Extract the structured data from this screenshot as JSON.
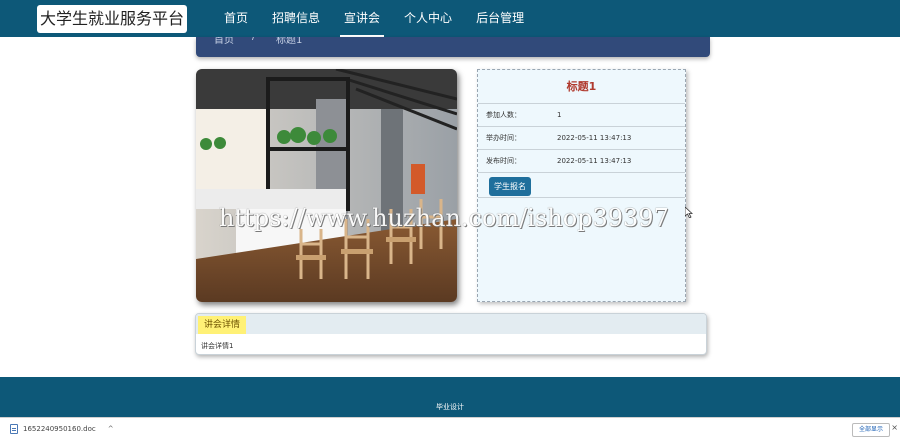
{
  "brand": {
    "title": "大学生就业服务平台"
  },
  "nav": {
    "items": [
      {
        "label": "首页",
        "active": false
      },
      {
        "label": "招聘信息",
        "active": false
      },
      {
        "label": "宣讲会",
        "active": true
      },
      {
        "label": "个人中心",
        "active": false
      },
      {
        "label": "后台管理",
        "active": false
      }
    ]
  },
  "breadcrumb": {
    "home": "首页",
    "separator": "/",
    "current": "标题1"
  },
  "event": {
    "title": "标题1",
    "fields": [
      {
        "label": "参加人数：",
        "value": "1"
      },
      {
        "label": "举办时间：",
        "value": "2022-05-11 13:47:13"
      },
      {
        "label": "发布时间：",
        "value": "2022-05-11 13:47:13"
      }
    ],
    "apply_label": "学生报名"
  },
  "watermark": "https://www.huzhan.com/ishop39397",
  "detail": {
    "tab_label": "讲会详情",
    "content": "讲会详情1"
  },
  "footer": {
    "text": "毕业设计"
  },
  "download": {
    "filename": "1652240950160.doc",
    "chevron": "^",
    "show_all": "全部显示",
    "close": "×"
  },
  "colors": {
    "nav_bg": "#0d5878",
    "breadcrumb_bg": "#314a7a",
    "title_red": "#b03a2e",
    "button_blue": "#1f6f9c",
    "tab_yellow": "#fff176"
  }
}
